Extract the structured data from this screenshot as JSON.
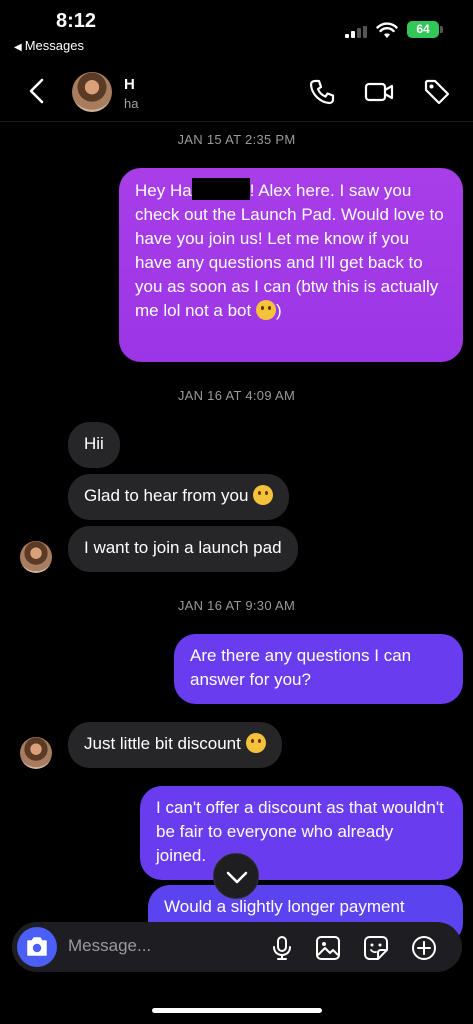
{
  "status_bar": {
    "time": "8:12",
    "back_app": "Messages",
    "battery": "64"
  },
  "header": {
    "contact_name": "H",
    "contact_handle": "ha"
  },
  "timestamps": [
    "JAN 15 AT 2:35 PM",
    "JAN 16 AT 4:09 AM",
    "JAN 16 AT 9:30 AM"
  ],
  "messages": {
    "m1_before": "Hey Ha",
    "m1_after": "! Alex here. I saw you check out the Launch Pad.  Would love to have you join us!  Let me know if you have any questions and I'll get back to you as soon as I can (btw this is actually me lol not a bot",
    "m1_end": ")",
    "m2": "Hii",
    "m3": "Glad to hear from you",
    "m4": "I want to join a launch pad",
    "m5": "Are there any questions I can answer for you?",
    "m6": "Just little bit discount",
    "m7": "I can't offer a discount as that wouldn't be fair to everyone who already joined.",
    "m8": "Would a slightly longer payment"
  },
  "composer": {
    "placeholder": "Message..."
  },
  "colors": {
    "outgoing_purple": "#a93ee8",
    "outgoing_blue": "#6a3cf0",
    "incoming": "#262629",
    "camera_button": "#4b5ef5"
  },
  "icons": [
    "chevron-left-icon",
    "phone-icon",
    "video-icon",
    "tag-icon",
    "camera-icon",
    "microphone-icon",
    "image-icon",
    "sticker-icon",
    "plus-circle-icon",
    "chevron-down-icon"
  ]
}
